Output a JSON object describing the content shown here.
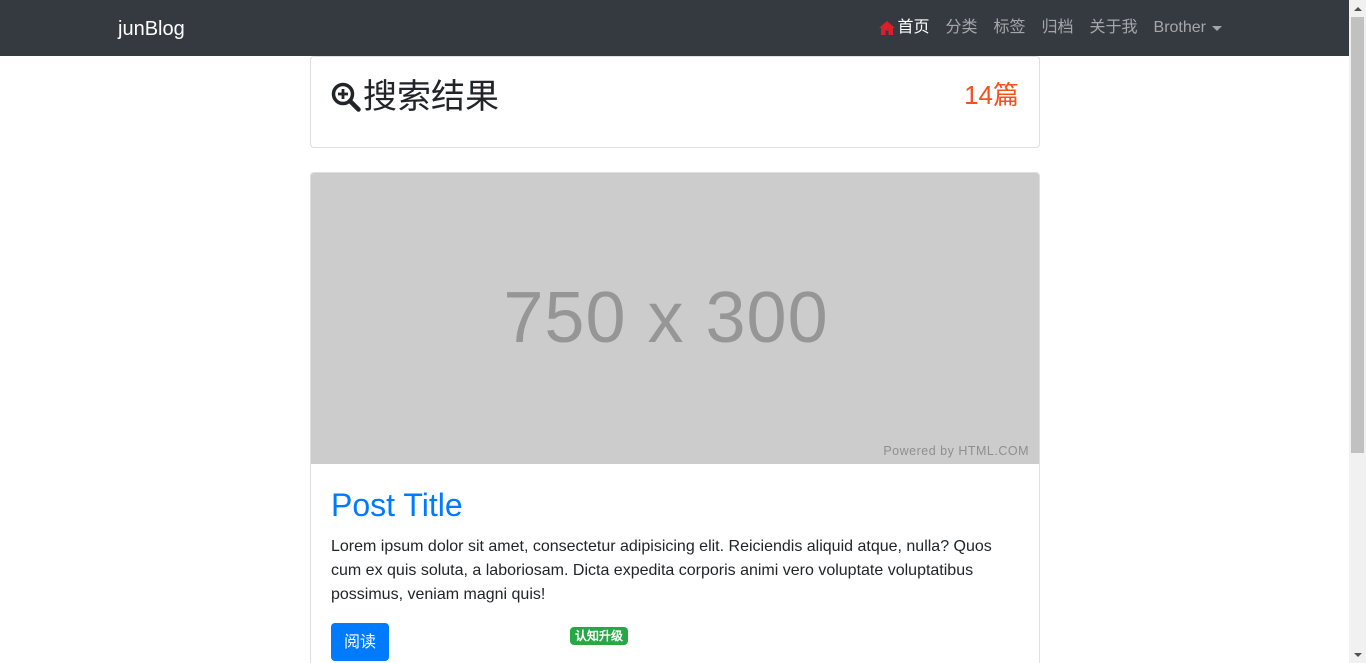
{
  "navbar": {
    "brand": "junBlog",
    "items": [
      {
        "label": "首页",
        "icon": "home-icon",
        "active": true
      },
      {
        "label": "分类"
      },
      {
        "label": "标签"
      },
      {
        "label": "归档"
      },
      {
        "label": "关于我"
      },
      {
        "label": "Brother",
        "dropdown": true
      }
    ]
  },
  "search": {
    "icon": "search-plus-icon",
    "title": "搜索结果",
    "count": "14篇"
  },
  "post": {
    "image_text": "750 x 300",
    "image_powered": "Powered by HTML.COM",
    "title": "Post Title",
    "excerpt": "Lorem ipsum dolor sit amet, consectetur adipisicing elit. Reiciendis aliquid atque, nulla? Quos cum ex quis soluta, a laboriosam. Dicta expedita corporis animi vero voluptate voluptatibus possimus, veniam magni quis!",
    "read_label": "阅读",
    "tag": "认知升级"
  },
  "colors": {
    "navbar_bg": "#343a40",
    "primary": "#007bff",
    "count": "#f4511e",
    "tag": "#28a745",
    "home_icon": "#dc1e2b"
  }
}
